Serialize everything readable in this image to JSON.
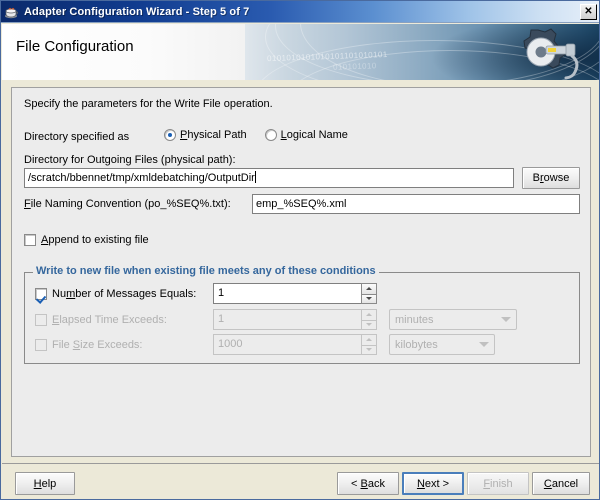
{
  "window": {
    "title": "Adapter Configuration Wizard - Step 5 of 7",
    "app_icon": "java-coffee-cup-icon",
    "close_label": "✕"
  },
  "banner": {
    "heading": "File Configuration",
    "binary_line_1": "0101010101010101101010101",
    "binary_line_2": "010101010",
    "art_icon": "gear-wrench-icon"
  },
  "content": {
    "intro": "Specify the parameters for the Write File operation.",
    "directory_specified_as_label": "Directory specified as",
    "radio_options": [
      {
        "label_pre": "",
        "mnemonic": "P",
        "label_post": "hysical Path",
        "selected": true
      },
      {
        "label_pre": "",
        "mnemonic": "L",
        "label_post": "ogical Name",
        "selected": false
      }
    ],
    "directory_label": "Directory for Outgoing Files (physical path):",
    "directory_value": "/scratch/bbennet/tmp/xmldebatching/OutputDir",
    "browse_button": {
      "pre": "B",
      "mnemonic": "r",
      "post": "owse"
    },
    "file_naming_label": {
      "mnemonic": "F",
      "post": "ile Naming Convention (po_%SEQ%.txt):"
    },
    "file_naming_value": "emp_%SEQ%.xml",
    "append_checkbox": {
      "mnemonic": "A",
      "post": "ppend to existing file",
      "checked": false
    },
    "group_title": "Write to new file when existing file meets any of these conditions",
    "conditions": [
      {
        "label_pre": "Nu",
        "mnemonic": "m",
        "label_post": "ber of Messages Equals:",
        "checked": true,
        "enabled": true,
        "value": "1",
        "unit": null
      },
      {
        "label_pre": "",
        "mnemonic": "E",
        "label_post": "lapsed Time Exceeds:",
        "checked": false,
        "enabled": false,
        "value": "1",
        "unit": "minutes"
      },
      {
        "label_pre": "File ",
        "mnemonic": "S",
        "label_post": "ize Exceeds:",
        "checked": false,
        "enabled": false,
        "value": "1000",
        "unit": "kilobytes"
      }
    ]
  },
  "footer": {
    "help": {
      "pre": "",
      "mnemonic": "H",
      "post": "elp"
    },
    "back": {
      "pre": "< ",
      "mnemonic": "B",
      "post": "ack"
    },
    "next": {
      "pre": "",
      "mnemonic": "N",
      "post": "ext >"
    },
    "finish": {
      "pre": "",
      "mnemonic": "F",
      "post": "inish"
    },
    "cancel": {
      "pre": "",
      "mnemonic": "C",
      "post": "ancel"
    }
  },
  "colors": {
    "title_bar_start": "#0b2a6b",
    "group_title_blue": "#35679d",
    "accent_blue": "#1a5fb4",
    "panel_bg": "#ececec",
    "focus_border": "#4a7ebb"
  }
}
